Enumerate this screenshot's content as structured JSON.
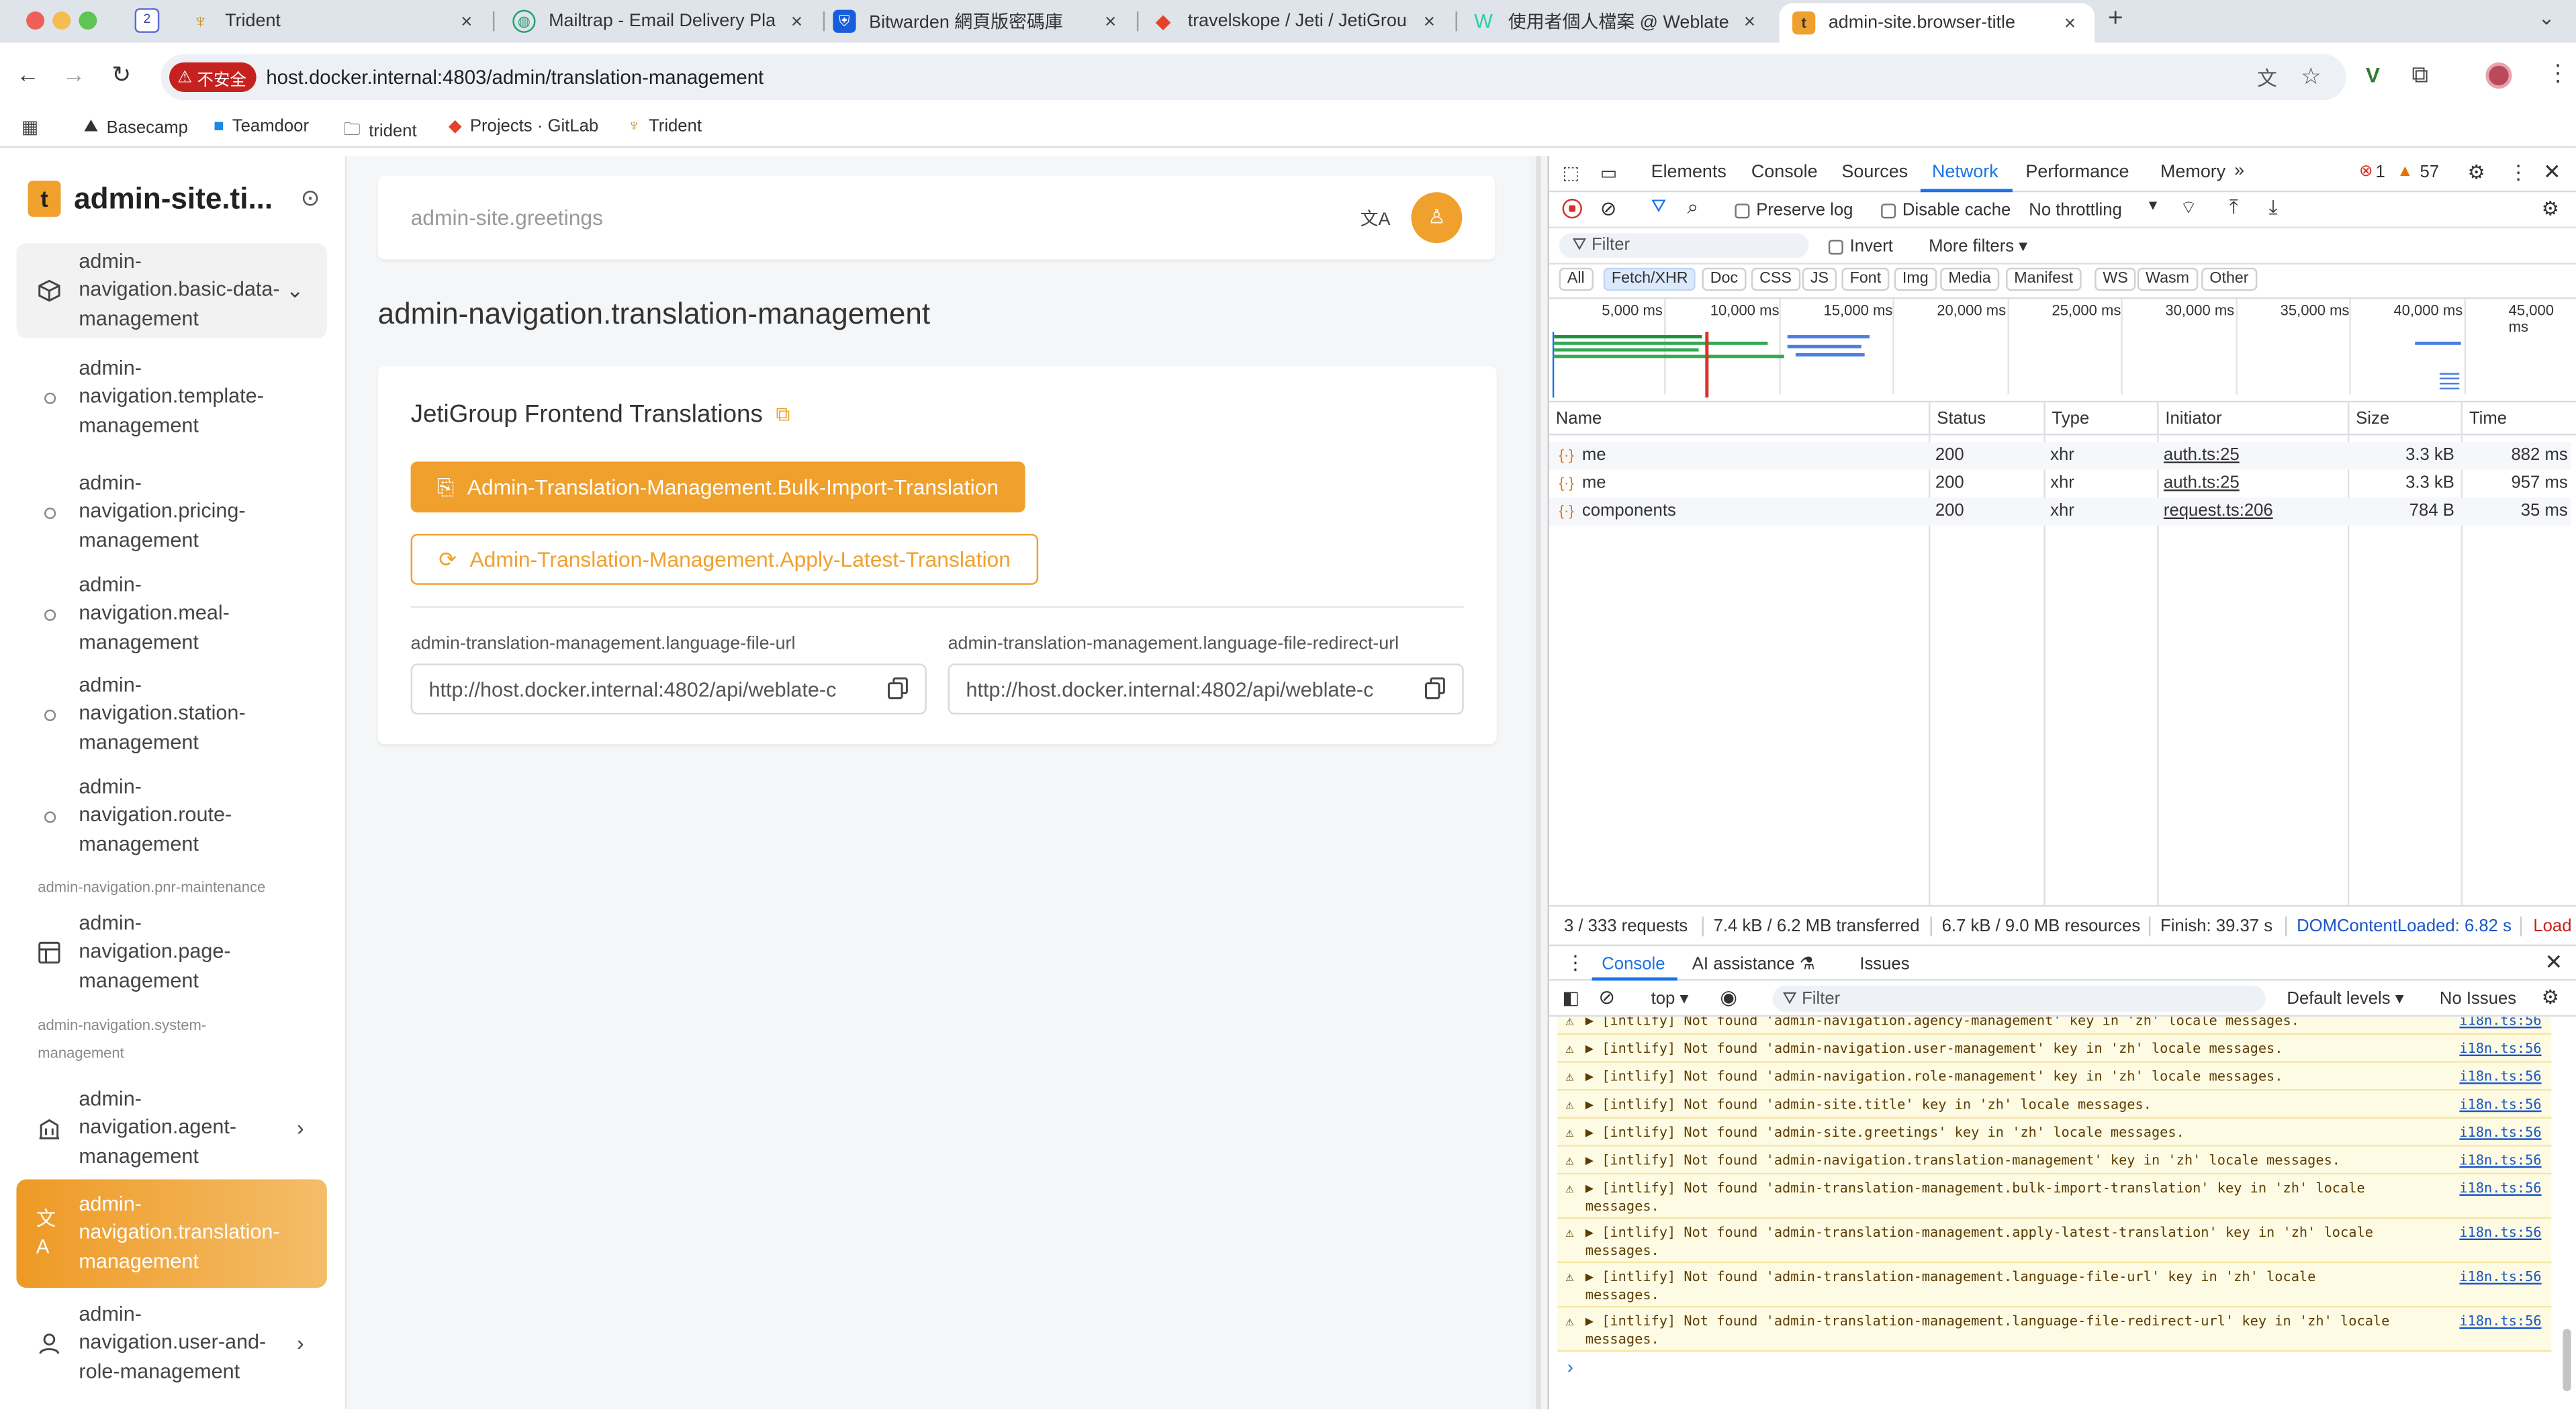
{
  "browser": {
    "tabs": [
      {
        "title": "Trident",
        "active": false
      },
      {
        "title": "Mailtrap - Email Delivery Platf",
        "active": false
      },
      {
        "title": "Bitwarden 網頁版密碼庫",
        "active": false
      },
      {
        "title": "travelskope / Jeti / JetiGroup",
        "active": false
      },
      {
        "title": "使用者個人檔案 @ Weblate",
        "active": false
      },
      {
        "title": "admin-site.browser-title",
        "active": true
      }
    ],
    "new_tab": "+",
    "security_label": "不安全",
    "url": "host.docker.internal:4803/admin/translation-management",
    "bookmarks": [
      "Basecamp",
      "Teamdoor",
      "trident",
      "Projects · GitLab",
      "Trident"
    ]
  },
  "app": {
    "brand": "admin-site.ti...",
    "sidebar": {
      "items": [
        {
          "label": "admin-navigation.basic-data-management",
          "icon": "cube-icon",
          "state": "expanded"
        },
        {
          "label": "admin-navigation.template-management",
          "icon": "dot-icon"
        },
        {
          "label": "admin-navigation.pricing-management",
          "icon": "dot-icon"
        },
        {
          "label": "admin-navigation.meal-management",
          "icon": "dot-icon"
        },
        {
          "label": "admin-navigation.station-management",
          "icon": "dot-icon"
        },
        {
          "label": "admin-navigation.route-management",
          "icon": "dot-icon"
        },
        {
          "label": "admin-navigation.page-management",
          "icon": "table-icon"
        },
        {
          "label": "admin-navigation.agent-management",
          "icon": "building-icon"
        },
        {
          "label": "admin-navigation.translation-management",
          "icon": "translate-icon",
          "state": "active"
        },
        {
          "label": "admin-navigation.user-and-role-management",
          "icon": "user-icon"
        }
      ],
      "groups": [
        "admin-navigation.pnr-maintenance",
        "admin-navigation.system-management"
      ]
    },
    "header": {
      "greeting": "admin-site.greetings"
    },
    "page_title": "admin-navigation.translation-management",
    "card": {
      "title": "JetiGroup Frontend Translations",
      "bulk_import_label": "Admin-Translation-Management.Bulk-Import-Translation",
      "apply_latest_label": "Admin-Translation-Management.Apply-Latest-Translation",
      "file_url_label": "admin-translation-management.language-file-url",
      "file_url_value": "http://host.docker.internal:4802/api/weblate-c",
      "redirect_url_label": "admin-translation-management.language-file-redirect-url",
      "redirect_url_value": "http://host.docker.internal:4802/api/weblate-c"
    },
    "colors": {
      "accent": "#f0a02c",
      "accent_dark": "#e8901a"
    }
  },
  "devtools": {
    "tabs": [
      "Elements",
      "Console",
      "Sources",
      "Network",
      "Performance",
      "Memory"
    ],
    "active_tab": "Network",
    "error_count": "1",
    "warning_count": "57",
    "network": {
      "preserve_log": "Preserve log",
      "disable_cache": "Disable cache",
      "throttling": "No throttling",
      "filter_placeholder": "Filter",
      "invert": "Invert",
      "more_filters": "More filters",
      "type_filters": [
        "All",
        "Fetch/XHR",
        "Doc",
        "CSS",
        "JS",
        "Font",
        "Img",
        "Media",
        "Manifest",
        "WS",
        "Wasm",
        "Other"
      ],
      "active_filter": "Fetch/XHR",
      "timeline_ticks": [
        "5,000 ms",
        "10,000 ms",
        "15,000 ms",
        "20,000 ms",
        "25,000 ms",
        "30,000 ms",
        "35,000 ms",
        "40,000 ms",
        "45,000 ms"
      ],
      "columns": [
        "Name",
        "Status",
        "Type",
        "Initiator",
        "Size",
        "Time"
      ],
      "rows": [
        {
          "name": "me",
          "status": "200",
          "type": "xhr",
          "initiator": "auth.ts:25",
          "size": "3.3 kB",
          "time": "882 ms"
        },
        {
          "name": "me",
          "status": "200",
          "type": "xhr",
          "initiator": "auth.ts:25",
          "size": "3.3 kB",
          "time": "957 ms"
        },
        {
          "name": "components",
          "status": "200",
          "type": "xhr",
          "initiator": "request.ts:206",
          "size": "784 B",
          "time": "35 ms"
        }
      ],
      "summary": {
        "requests": "3 / 333 requests",
        "transferred": "7.4 kB / 6.2 MB transferred",
        "resources": "6.7 kB / 9.0 MB resources",
        "finish": "Finish: 39.37 s",
        "dom_loaded": "DOMContentLoaded: 6.82 s",
        "load": "Load"
      }
    },
    "drawer": {
      "tabs": [
        "Console",
        "AI assistance",
        "Issues"
      ],
      "context": "top",
      "filter_placeholder": "Filter",
      "levels": "Default levels",
      "issues": "No Issues",
      "messages": [
        {
          "text": "▶ [intlify] Not found 'admin-navigation.agency-management' key in 'zh' locale messages.",
          "source": "i18n.ts:56"
        },
        {
          "text": "▶ [intlify] Not found 'admin-navigation.user-management' key in 'zh' locale messages.",
          "source": "i18n.ts:56"
        },
        {
          "text": "▶ [intlify] Not found 'admin-navigation.role-management' key in 'zh' locale messages.",
          "source": "i18n.ts:56"
        },
        {
          "text": "▶ [intlify] Not found 'admin-site.title' key in 'zh' locale messages.",
          "source": "i18n.ts:56"
        },
        {
          "text": "▶ [intlify] Not found 'admin-site.greetings' key in 'zh' locale messages.",
          "source": "i18n.ts:56"
        },
        {
          "text": "▶ [intlify] Not found 'admin-navigation.translation-management' key in 'zh' locale messages.",
          "source": "i18n.ts:56"
        },
        {
          "text": "▶ [intlify] Not found 'admin-translation-management.bulk-import-translation' key in 'zh' locale messages.",
          "source": "i18n.ts:56"
        },
        {
          "text": "▶ [intlify] Not found 'admin-translation-management.apply-latest-translation' key in 'zh' locale messages.",
          "source": "i18n.ts:56"
        },
        {
          "text": "▶ [intlify] Not found 'admin-translation-management.language-file-url' key in 'zh' locale messages.",
          "source": "i18n.ts:56"
        },
        {
          "text": "▶ [intlify] Not found 'admin-translation-management.language-file-redirect-url' key in 'zh' locale messages.",
          "source": "i18n.ts:56"
        }
      ],
      "prompt": "›"
    }
  }
}
